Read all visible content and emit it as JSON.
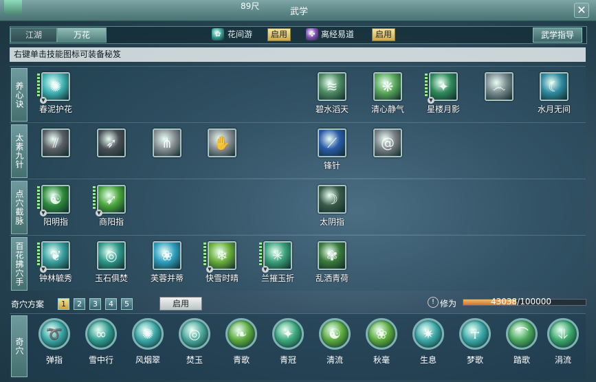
{
  "window": {
    "distance": "89尺",
    "title": "武学",
    "close_label": "✕"
  },
  "tabs": [
    {
      "label": "江湖"
    },
    {
      "label": "万花"
    }
  ],
  "schools": [
    {
      "name": "花间游",
      "enable_label": "启用",
      "icon": "flower-school-icon",
      "color": "#3aa39a"
    },
    {
      "name": "离经易道",
      "enable_label": "启用",
      "icon": "healing-school-icon",
      "color": "#8a4fb8"
    }
  ],
  "guide_label": "武学指导",
  "hint": "右键单击技能图标可装备秘笈",
  "rows": [
    {
      "label": "养心诀",
      "skills": [
        {
          "name": "春泥护花",
          "icon": "spring-mud-icon",
          "color": "#3fb4b4",
          "secret": true
        },
        {
          "name": "碧水滔天",
          "icon": "blue-water-icon",
          "color": "#4e8a62",
          "secret": false
        },
        {
          "name": "清心静气",
          "icon": "clear-mind-icon",
          "color": "#5aa85a",
          "secret": false
        },
        {
          "name": "星楼月影",
          "icon": "star-tower-icon",
          "color": "#2f8a5a",
          "secret": true
        },
        {
          "name": "",
          "icon": "swirl-icon",
          "color": "#7a8a8e",
          "secret": false
        },
        {
          "name": "水月无间",
          "icon": "water-moon-icon",
          "color": "#2f8aa0",
          "secret": false
        }
      ]
    },
    {
      "label": "太素九针",
      "skills": [
        {
          "name": "",
          "icon": "needle-icon",
          "color": "#5a5f66",
          "secret": false
        },
        {
          "name": "",
          "icon": "blade-icon",
          "color": "#4a4f55",
          "secret": false
        },
        {
          "name": "",
          "icon": "hand-icon",
          "color": "#8a9095",
          "secret": false
        },
        {
          "name": "",
          "icon": "palm-icon",
          "color": "#8a9095",
          "secret": false
        },
        {
          "name": "锋针",
          "icon": "sharp-needle-icon",
          "color": "#2a5aa8",
          "secret": false
        },
        {
          "name": "",
          "icon": "vortex-icon",
          "color": "#7a8085",
          "secret": false
        }
      ]
    },
    {
      "label": "点穴截脉",
      "skills": [
        {
          "name": "阳明指",
          "icon": "yangming-icon",
          "color": "#2f8a3a",
          "secret": true
        },
        {
          "name": "商阳指",
          "icon": "shangyang-icon",
          "color": "#4aa83a",
          "secret": true
        },
        {
          "name": "太阴指",
          "icon": "taiyin-icon",
          "color": "#3a5a48",
          "secret": false
        }
      ]
    },
    {
      "label": "百花拂穴手",
      "skills": [
        {
          "name": "钟林毓秀",
          "icon": "forest-icon",
          "color": "#3aa0a0",
          "secret": true
        },
        {
          "name": "玉石俱焚",
          "icon": "jade-icon",
          "color": "#2f9a8a",
          "secret": false
        },
        {
          "name": "芙蓉并蒂",
          "icon": "lotus-icon",
          "color": "#2fa0c0",
          "secret": false
        },
        {
          "name": "快雪时晴",
          "icon": "snow-icon",
          "color": "#6ab03a",
          "secret": true
        },
        {
          "name": "兰摧玉折",
          "icon": "orchid-icon",
          "color": "#3aa07a",
          "secret": true
        },
        {
          "name": "乱洒青荷",
          "icon": "green-lotus-icon",
          "color": "#3a7a3a",
          "secret": false
        }
      ]
    }
  ],
  "plan": {
    "label": "奇穴方案",
    "options": [
      "1",
      "2",
      "3",
      "4",
      "5"
    ],
    "active": "1",
    "apply_label": "启用"
  },
  "xiuwei": {
    "info": "!",
    "label": "修为",
    "value": "43038/100000",
    "fraction": 0.43
  },
  "qixue_label": "奇穴",
  "qixue": [
    {
      "name": "弹指",
      "icon": "flick-icon",
      "color": "#3aa6a6"
    },
    {
      "name": "雪中行",
      "icon": "snow-walk-icon",
      "color": "#2f9a8e"
    },
    {
      "name": "风烟翠",
      "icon": "wind-smoke-icon",
      "color": "#3aa6a6"
    },
    {
      "name": "焚玉",
      "icon": "burning-jade-icon",
      "color": "#4aa69a"
    },
    {
      "name": "青歌",
      "icon": "green-song-icon",
      "color": "#5aa83a"
    },
    {
      "name": "青冠",
      "icon": "green-crown-icon",
      "color": "#3aa67a"
    },
    {
      "name": "清流",
      "icon": "clear-stream-icon",
      "color": "#5aa83a"
    },
    {
      "name": "秋毫",
      "icon": "autumn-hair-icon",
      "color": "#5aa83a"
    },
    {
      "name": "生息",
      "icon": "breath-icon",
      "color": "#3aa6a6"
    },
    {
      "name": "梦歌",
      "icon": "dream-song-icon",
      "color": "#3aa6a6"
    },
    {
      "name": "踏歌",
      "icon": "dance-song-icon",
      "color": "#4aa65a"
    },
    {
      "name": "涓流",
      "icon": "trickle-icon",
      "color": "#3aa66a"
    }
  ]
}
